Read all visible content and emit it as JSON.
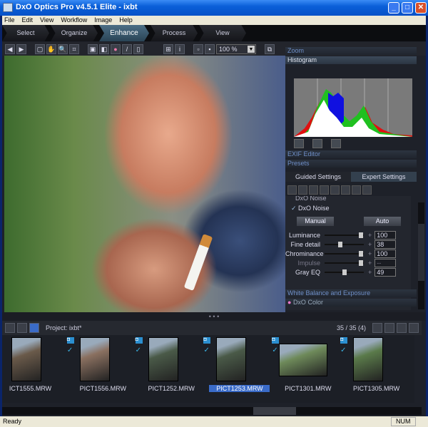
{
  "window": {
    "title": "DxO Optics Pro v4.5.1 Elite - ixbt",
    "min": "_",
    "max": "□",
    "close": "✕"
  },
  "menu": [
    "File",
    "Edit",
    "View",
    "Workflow",
    "Image",
    "Help"
  ],
  "tabs": [
    "Select",
    "Organize",
    "Enhance",
    "Process",
    "View"
  ],
  "toolbar": {
    "zoom": "100 %"
  },
  "panel": {
    "zoom": "Zoom",
    "histogram": "Histogram",
    "exif": "EXIF Editor",
    "presets": "Presets",
    "guided": "Guided Settings",
    "expert": "Expert Settings",
    "noise_header": "DxO Noise",
    "noise_title": "DxO Noise",
    "manual": "Manual",
    "auto": "Auto",
    "sliders": [
      {
        "label": "Luminance",
        "value": "100",
        "pos": 0.95
      },
      {
        "label": "Fine detail",
        "value": "38",
        "pos": 0.38
      },
      {
        "label": "Chrominance",
        "value": "100",
        "pos": 0.95
      },
      {
        "label": "Impulse",
        "value": "--",
        "pos": 0.95
      },
      {
        "label": "Gray EQ",
        "value": "49",
        "pos": 0.49
      }
    ],
    "wb": "White Balance and Exposure",
    "color": "DxO Color"
  },
  "filmstrip": {
    "project": "Project:  ixbt*",
    "count": "35 / 35 (4)",
    "items": [
      {
        "name": "ICT1555.MRW",
        "color": "#6a5a4a"
      },
      {
        "name": "PICT1556.MRW",
        "color": "#8a7060"
      },
      {
        "name": "PICT1252.MRW",
        "color": "#4a5a48"
      },
      {
        "name": "PICT1253.MRW",
        "color": "#4a5a48",
        "selected": true
      },
      {
        "name": "PICT1301.MRW",
        "color": "#6e8a5a"
      },
      {
        "name": "PICT1305.MRW",
        "color": "#5a7a4a"
      }
    ]
  },
  "status": {
    "text": "Ready",
    "num": "NUM"
  },
  "splitter": "• • •"
}
